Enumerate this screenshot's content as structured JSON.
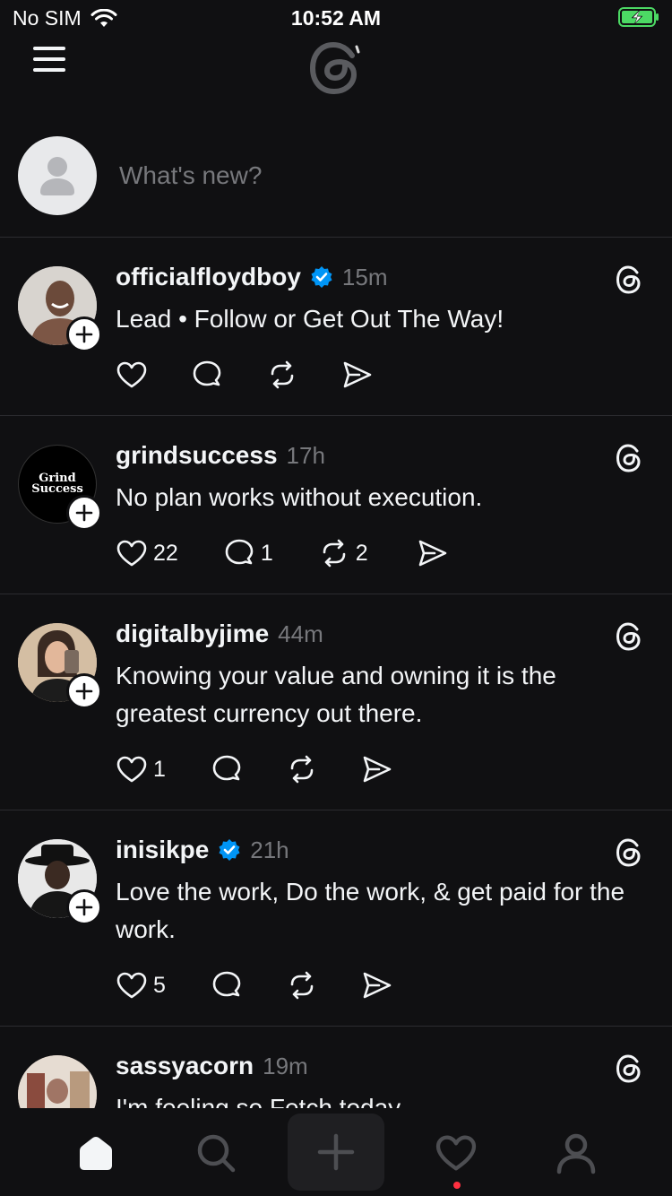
{
  "status_bar": {
    "carrier": "No SIM",
    "time": "10:52 AM",
    "battery_charging": true
  },
  "composer": {
    "placeholder": "What's new?"
  },
  "posts": [
    {
      "username": "officialfloydboy",
      "verified": true,
      "time": "15m",
      "text": "Lead • Follow or Get Out The Way!",
      "likes": "",
      "replies": "",
      "reposts": ""
    },
    {
      "username": "grindsuccess",
      "verified": false,
      "time": "17h",
      "text": "No plan works without execution.",
      "avatar_text": "Grind Success",
      "likes": "22",
      "replies": "1",
      "reposts": "2"
    },
    {
      "username": "digitalbyjime",
      "verified": false,
      "time": "44m",
      "text": "Knowing your value and owning it is the greatest currency out there.",
      "likes": "1",
      "replies": "",
      "reposts": ""
    },
    {
      "username": "inisikpe",
      "verified": true,
      "time": "21h",
      "text": "Love the work, Do the work, & get paid for the work.",
      "likes": "5",
      "replies": "",
      "reposts": ""
    },
    {
      "username": "sassyacorn",
      "verified": false,
      "time": "19m",
      "text": "I'm feeling so Fetch today"
    }
  ],
  "tabs": [
    "home-icon",
    "search-icon",
    "new-thread-icon",
    "activity-icon",
    "profile-icon"
  ],
  "colors": {
    "background": "#101012",
    "verified": "#0095f6",
    "notification": "#ff3040",
    "muted": "#77787c"
  }
}
